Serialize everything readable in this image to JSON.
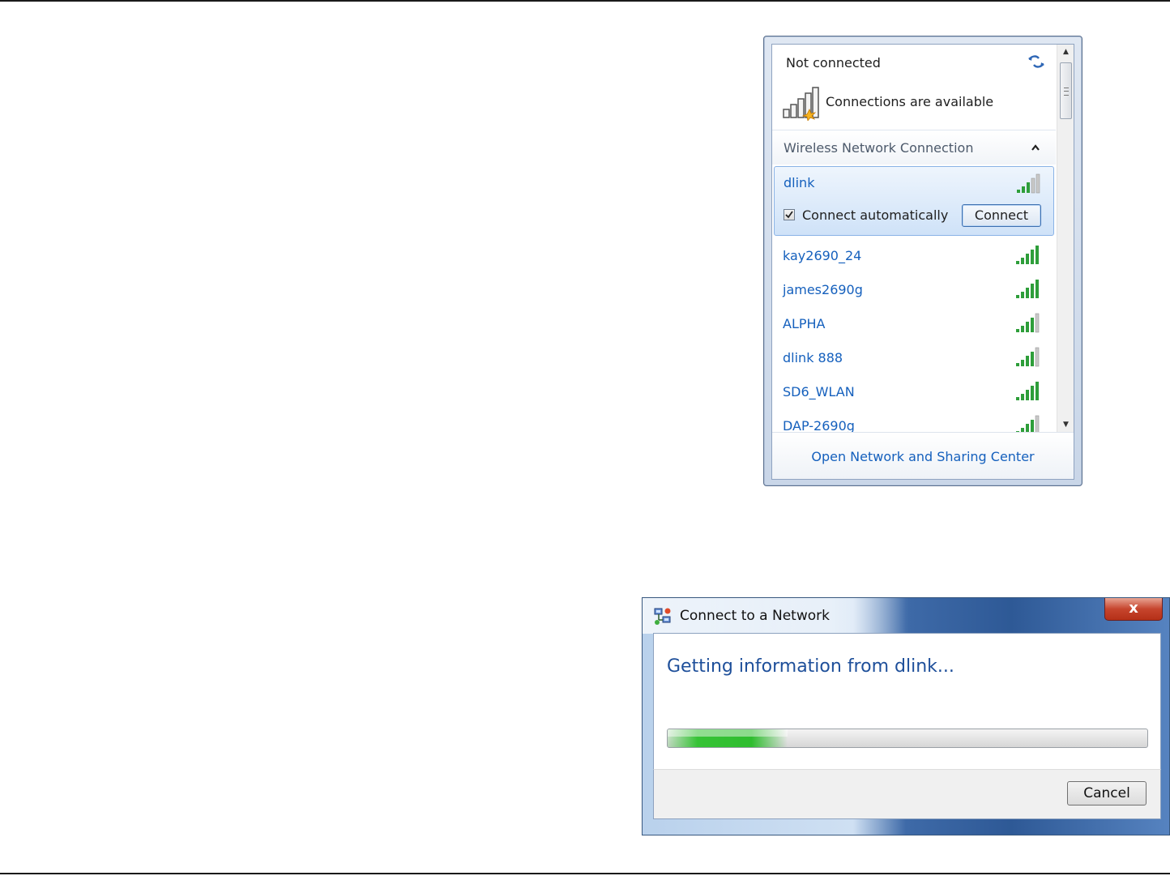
{
  "flyout": {
    "status_title": "Not connected",
    "status_sub": "Connections are available",
    "section_label": "Wireless Network Connection",
    "selected": {
      "ssid": "dlink",
      "auto_label": "Connect automatically",
      "auto_checked": true,
      "connect_label": "Connect"
    },
    "networks": [
      {
        "ssid": "kay2690_24"
      },
      {
        "ssid": "james2690g"
      },
      {
        "ssid": "ALPHA"
      },
      {
        "ssid": "dlink 888"
      },
      {
        "ssid": "SD6_WLAN"
      },
      {
        "ssid": "DAP-2690g"
      }
    ],
    "footer_link": "Open Network and Sharing Center"
  },
  "dialog": {
    "title": "Connect to a Network",
    "close_label": "x",
    "message": "Getting information from dlink...",
    "progress_percent": 25,
    "cancel_label": "Cancel"
  },
  "colors": {
    "link": "#1560bd",
    "signal_green": "#2e9e3a",
    "progress_green": "#36c336"
  }
}
